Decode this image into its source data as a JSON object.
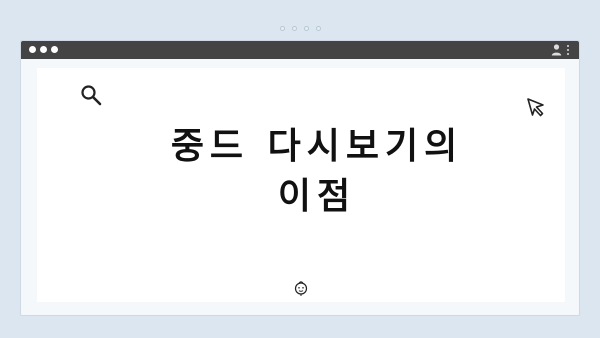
{
  "page": {
    "title": "중드 다시보기의 이점"
  },
  "icons": {
    "search": "search-icon",
    "cursor": "cursor-icon",
    "face": "face-icon",
    "user": "user-icon",
    "more": "kebab-menu-icon"
  },
  "colors": {
    "background": "#dce6f0",
    "titlebar": "#444444",
    "window": "#f4f8fb",
    "content": "#ffffff",
    "text": "#111111"
  }
}
